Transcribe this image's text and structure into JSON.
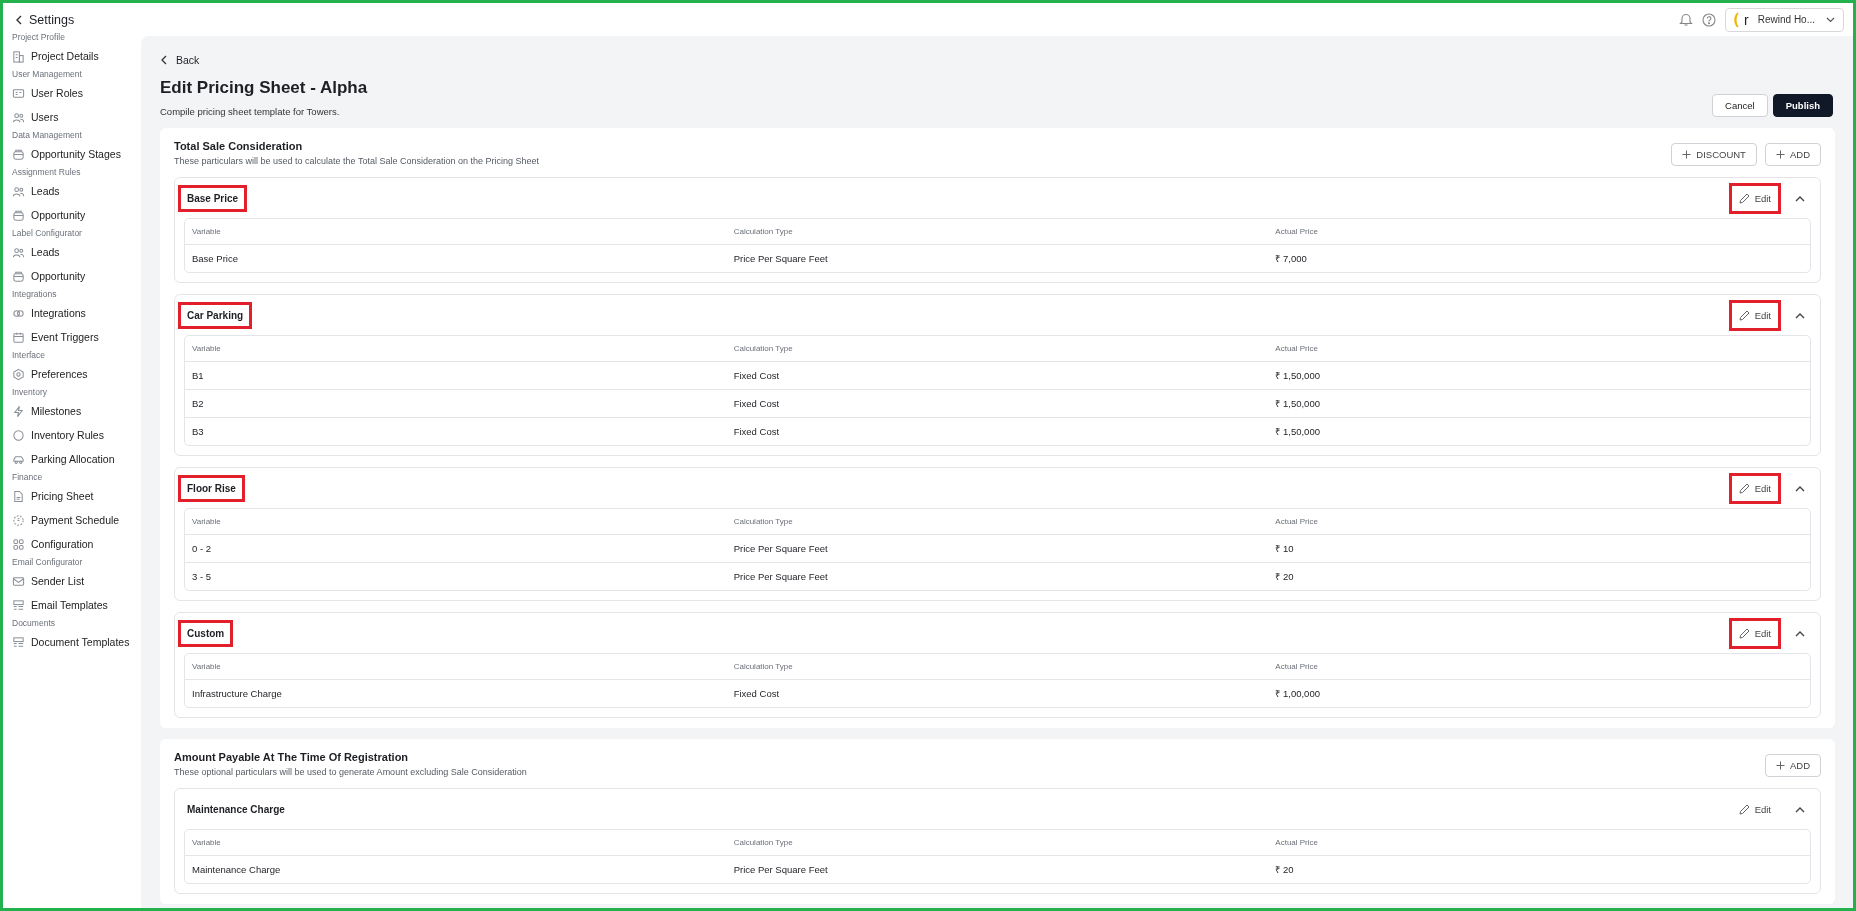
{
  "sidebar": {
    "back_label": "Settings",
    "groups": [
      {
        "label": "Project Profile",
        "items": [
          "Project Details"
        ]
      },
      {
        "label": "User Management",
        "items": [
          "User Roles",
          "Users"
        ]
      },
      {
        "label": "Data Management",
        "items": [
          "Opportunity Stages"
        ]
      },
      {
        "label": "Assignment Rules",
        "items": [
          "Leads",
          "Opportunity"
        ]
      },
      {
        "label": "Label Configurator",
        "items": [
          "Leads",
          "Opportunity"
        ]
      },
      {
        "label": "Integrations",
        "items": [
          "Integrations",
          "Event Triggers"
        ]
      },
      {
        "label": "Interface",
        "items": [
          "Preferences"
        ]
      },
      {
        "label": "Inventory",
        "items": [
          "Milestones",
          "Inventory Rules",
          "Parking Allocation"
        ]
      },
      {
        "label": "Finance",
        "items": [
          "Pricing Sheet",
          "Payment Schedule",
          "Configuration"
        ]
      },
      {
        "label": "Email Configurator",
        "items": [
          "Sender List",
          "Email Templates"
        ]
      },
      {
        "label": "Documents",
        "items": [
          "Document Templates"
        ]
      }
    ]
  },
  "topbar": {
    "logo_letter": "r",
    "account": "Rewind Ho..."
  },
  "back": "Back",
  "title": "Edit Pricing Sheet - Alpha",
  "subtitle": "Compile pricing sheet template for Towers.",
  "actions": [
    {
      "label": "Cancel",
      "kind": "secondary"
    },
    {
      "label": "Publish",
      "kind": "primary"
    }
  ],
  "sections": [
    {
      "title": "Total Sale Consideration",
      "description": "These particulars will be used to calculate the Total Sale Consideration on the Pricing Sheet",
      "buttons": [
        "DISCOUNT",
        "ADD"
      ],
      "cards": [
        {
          "title": "Base Price",
          "highlighted": true,
          "edit": "Edit",
          "edit_highlighted": true,
          "expanded": true,
          "columns": [
            "Variable",
            "Calculation Type",
            "Actual Price"
          ],
          "rows": [
            [
              "Base Price",
              "Price Per Square Feet",
              "₹ 7,000"
            ]
          ]
        },
        {
          "title": "Car Parking",
          "highlighted": true,
          "edit": "Edit",
          "edit_highlighted": true,
          "expanded": true,
          "columns": [
            "Variable",
            "Calculation Type",
            "Actual Price"
          ],
          "rows": [
            [
              "B1",
              "Fixed Cost",
              "₹ 1,50,000"
            ],
            [
              "B2",
              "Fixed Cost",
              "₹ 1,50,000"
            ],
            [
              "B3",
              "Fixed Cost",
              "₹ 1,50,000"
            ]
          ]
        },
        {
          "title": "Floor Rise",
          "highlighted": true,
          "edit": "Edit",
          "edit_highlighted": true,
          "expanded": true,
          "columns": [
            "Variable",
            "Calculation Type",
            "Actual Price"
          ],
          "rows": [
            [
              "0 - 2",
              "Price Per Square Feet",
              "₹ 10"
            ],
            [
              "3 - 5",
              "Price Per Square Feet",
              "₹ 20"
            ]
          ]
        },
        {
          "title": "Custom",
          "highlighted": true,
          "edit": "Edit",
          "edit_highlighted": true,
          "expanded": true,
          "columns": [
            "Variable",
            "Calculation Type",
            "Actual Price"
          ],
          "rows": [
            [
              "Infrastructure Charge",
              "Fixed Cost",
              "₹ 1,00,000"
            ]
          ]
        }
      ]
    },
    {
      "title": "Amount Payable At The Time Of Registration",
      "description": "These optional particulars will be used to generate Amount excluding Sale Consideration",
      "buttons": [
        "ADD"
      ],
      "cards": [
        {
          "title": "Maintenance Charge",
          "highlighted": false,
          "edit": "Edit",
          "edit_highlighted": false,
          "expanded": true,
          "columns": [
            "Variable",
            "Calculation Type",
            "Actual Price"
          ],
          "rows": [
            [
              "Maintenance Charge",
              "Price Per Square Feet",
              "₹ 20"
            ]
          ]
        }
      ]
    }
  ]
}
